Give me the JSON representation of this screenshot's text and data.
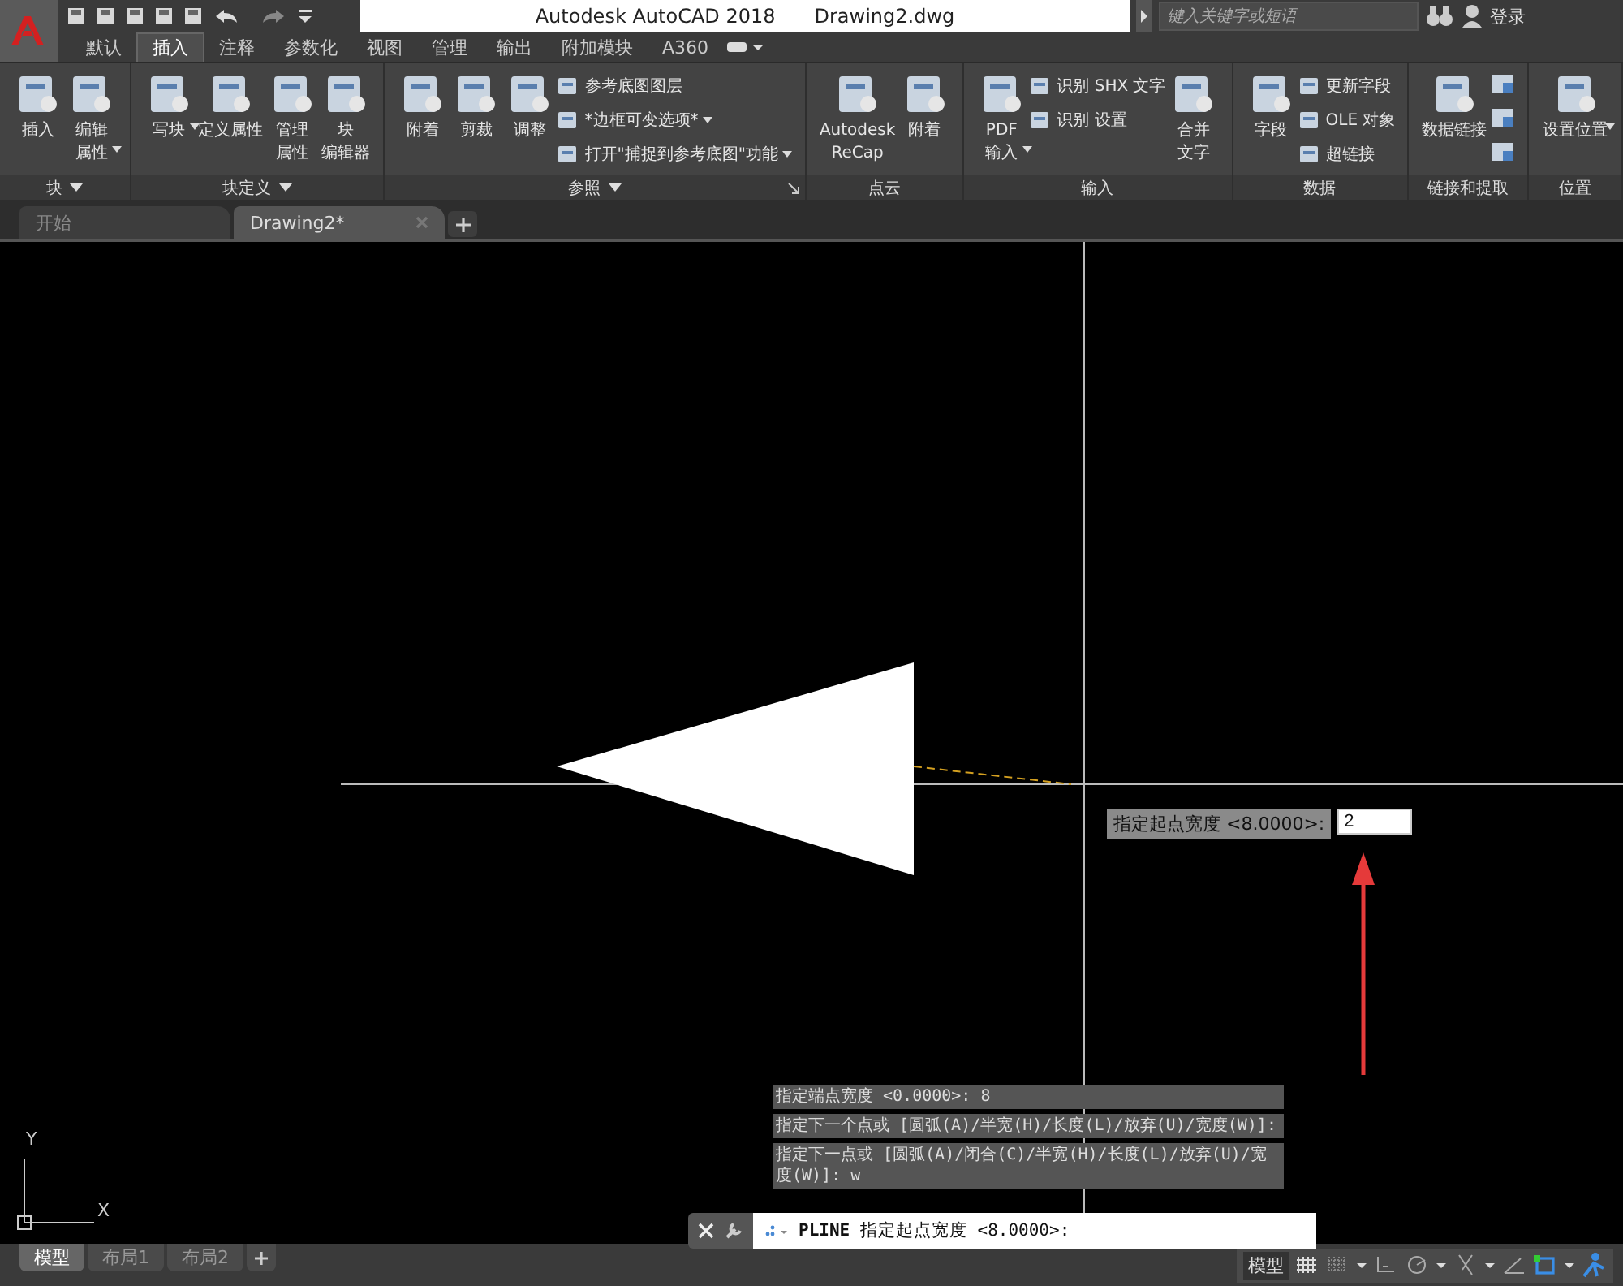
{
  "title_bar": {
    "app_name": "Autodesk AutoCAD 2018",
    "file_name": "Drawing2.dwg",
    "search": {
      "placeholder": "键入关键字或短语"
    },
    "sign_in": "登录"
  },
  "ribbon_tabs": [
    {
      "label": "默认",
      "selected": false
    },
    {
      "label": "插入",
      "selected": true
    },
    {
      "label": "注释",
      "selected": false
    },
    {
      "label": "参数化",
      "selected": false
    },
    {
      "label": "视图",
      "selected": false
    },
    {
      "label": "管理",
      "selected": false
    },
    {
      "label": "输出",
      "selected": false
    },
    {
      "label": "附加模块",
      "selected": false
    },
    {
      "label": "A360",
      "selected": false
    }
  ],
  "ribbon_panels": [
    {
      "title": "块",
      "menu": true,
      "launcher": false,
      "items": [
        {
          "kind": "large",
          "lines": [
            "插入"
          ],
          "dropdown": false
        },
        {
          "kind": "large",
          "lines": [
            "编辑",
            "属性"
          ],
          "dropdown": true
        }
      ]
    },
    {
      "title": "块定义",
      "menu": true,
      "launcher": false,
      "items": [
        {
          "kind": "large",
          "lines": [
            "写块"
          ],
          "dropdown": true
        },
        {
          "kind": "large",
          "lines": [
            "定义属性"
          ],
          "dropdown": false
        },
        {
          "kind": "large",
          "lines": [
            "管理",
            "属性"
          ],
          "dropdown": false
        },
        {
          "kind": "large",
          "lines": [
            "块",
            "编辑器"
          ],
          "dropdown": false
        }
      ]
    },
    {
      "title": "参照",
      "menu": true,
      "launcher": true,
      "items": [
        {
          "kind": "large",
          "lines": [
            "附着"
          ],
          "dropdown": false
        },
        {
          "kind": "large",
          "lines": [
            "剪裁"
          ],
          "dropdown": false
        },
        {
          "kind": "large",
          "lines": [
            "调整"
          ],
          "dropdown": false
        },
        {
          "kind": "stack",
          "items": [
            {
              "label": "参考底图图层",
              "dropdown": false
            },
            {
              "label": "*边框可变选项*",
              "dropdown": true
            },
            {
              "label": "打开\"捕捉到参考底图\"功能",
              "dropdown": true
            }
          ]
        }
      ]
    },
    {
      "title": "点云",
      "menu": false,
      "launcher": false,
      "items": [
        {
          "kind": "large",
          "lines": [
            "Autodesk",
            "ReCap"
          ],
          "dropdown": false
        },
        {
          "kind": "large",
          "lines": [
            "附着"
          ],
          "dropdown": false
        }
      ]
    },
    {
      "title": "输入",
      "menu": false,
      "launcher": false,
      "items": [
        {
          "kind": "large",
          "lines": [
            "PDF",
            "输入"
          ],
          "dropdown": true
        },
        {
          "kind": "stack",
          "items": [
            {
              "label": "识别 SHX 文字",
              "dropdown": false
            },
            {
              "label": "识别 设置",
              "dropdown": false
            }
          ]
        },
        {
          "kind": "large",
          "lines": [
            "合并",
            "文字"
          ],
          "dropdown": false
        }
      ]
    },
    {
      "title": "数据",
      "menu": false,
      "launcher": false,
      "items": [
        {
          "kind": "large",
          "lines": [
            "字段"
          ],
          "dropdown": false
        },
        {
          "kind": "stack",
          "items": [
            {
              "label": "更新字段",
              "dropdown": false
            },
            {
              "label": "OLE 对象",
              "dropdown": false
            },
            {
              "label": "超链接",
              "dropdown": false
            }
          ]
        }
      ]
    },
    {
      "title": "链接和提取",
      "menu": false,
      "launcher": false,
      "items": [
        {
          "kind": "large",
          "lines": [
            "数据链接"
          ],
          "dropdown": false
        },
        {
          "kind": "icon_stack"
        }
      ]
    },
    {
      "title": "位置",
      "menu": false,
      "launcher": false,
      "items": [
        {
          "kind": "large",
          "lines": [
            "设置位置"
          ],
          "dropdown": true
        }
      ]
    }
  ],
  "doc_tabs": [
    {
      "label": "开始",
      "selected": false,
      "closable": false
    },
    {
      "label": "Drawing2*",
      "selected": true,
      "closable": true
    }
  ],
  "canvas": {
    "dynamic_input": {
      "prompt": "指定起点宽度 <8.0000>:",
      "value": "2"
    },
    "ucs": {
      "y_label": "Y",
      "x_label": "X"
    }
  },
  "command_history": [
    "指定端点宽度 <0.0000>: 8",
    "指定下一个点或 [圆弧(A)/半宽(H)/长度(L)/放弃(U)/宽度(W)]:",
    "指定下一点或 [圆弧(A)/闭合(C)/半宽(H)/长度(L)/放弃(U)/宽度(W)]: w"
  ],
  "command_line": {
    "text": "**PLINE** 指定起点宽度 <8.0000>:"
  },
  "layout_tabs": [
    {
      "label": "模型",
      "selected": true
    },
    {
      "label": "布局1",
      "selected": false
    },
    {
      "label": "布局2",
      "selected": false
    }
  ],
  "status_bar": {
    "model_button": "模型"
  }
}
